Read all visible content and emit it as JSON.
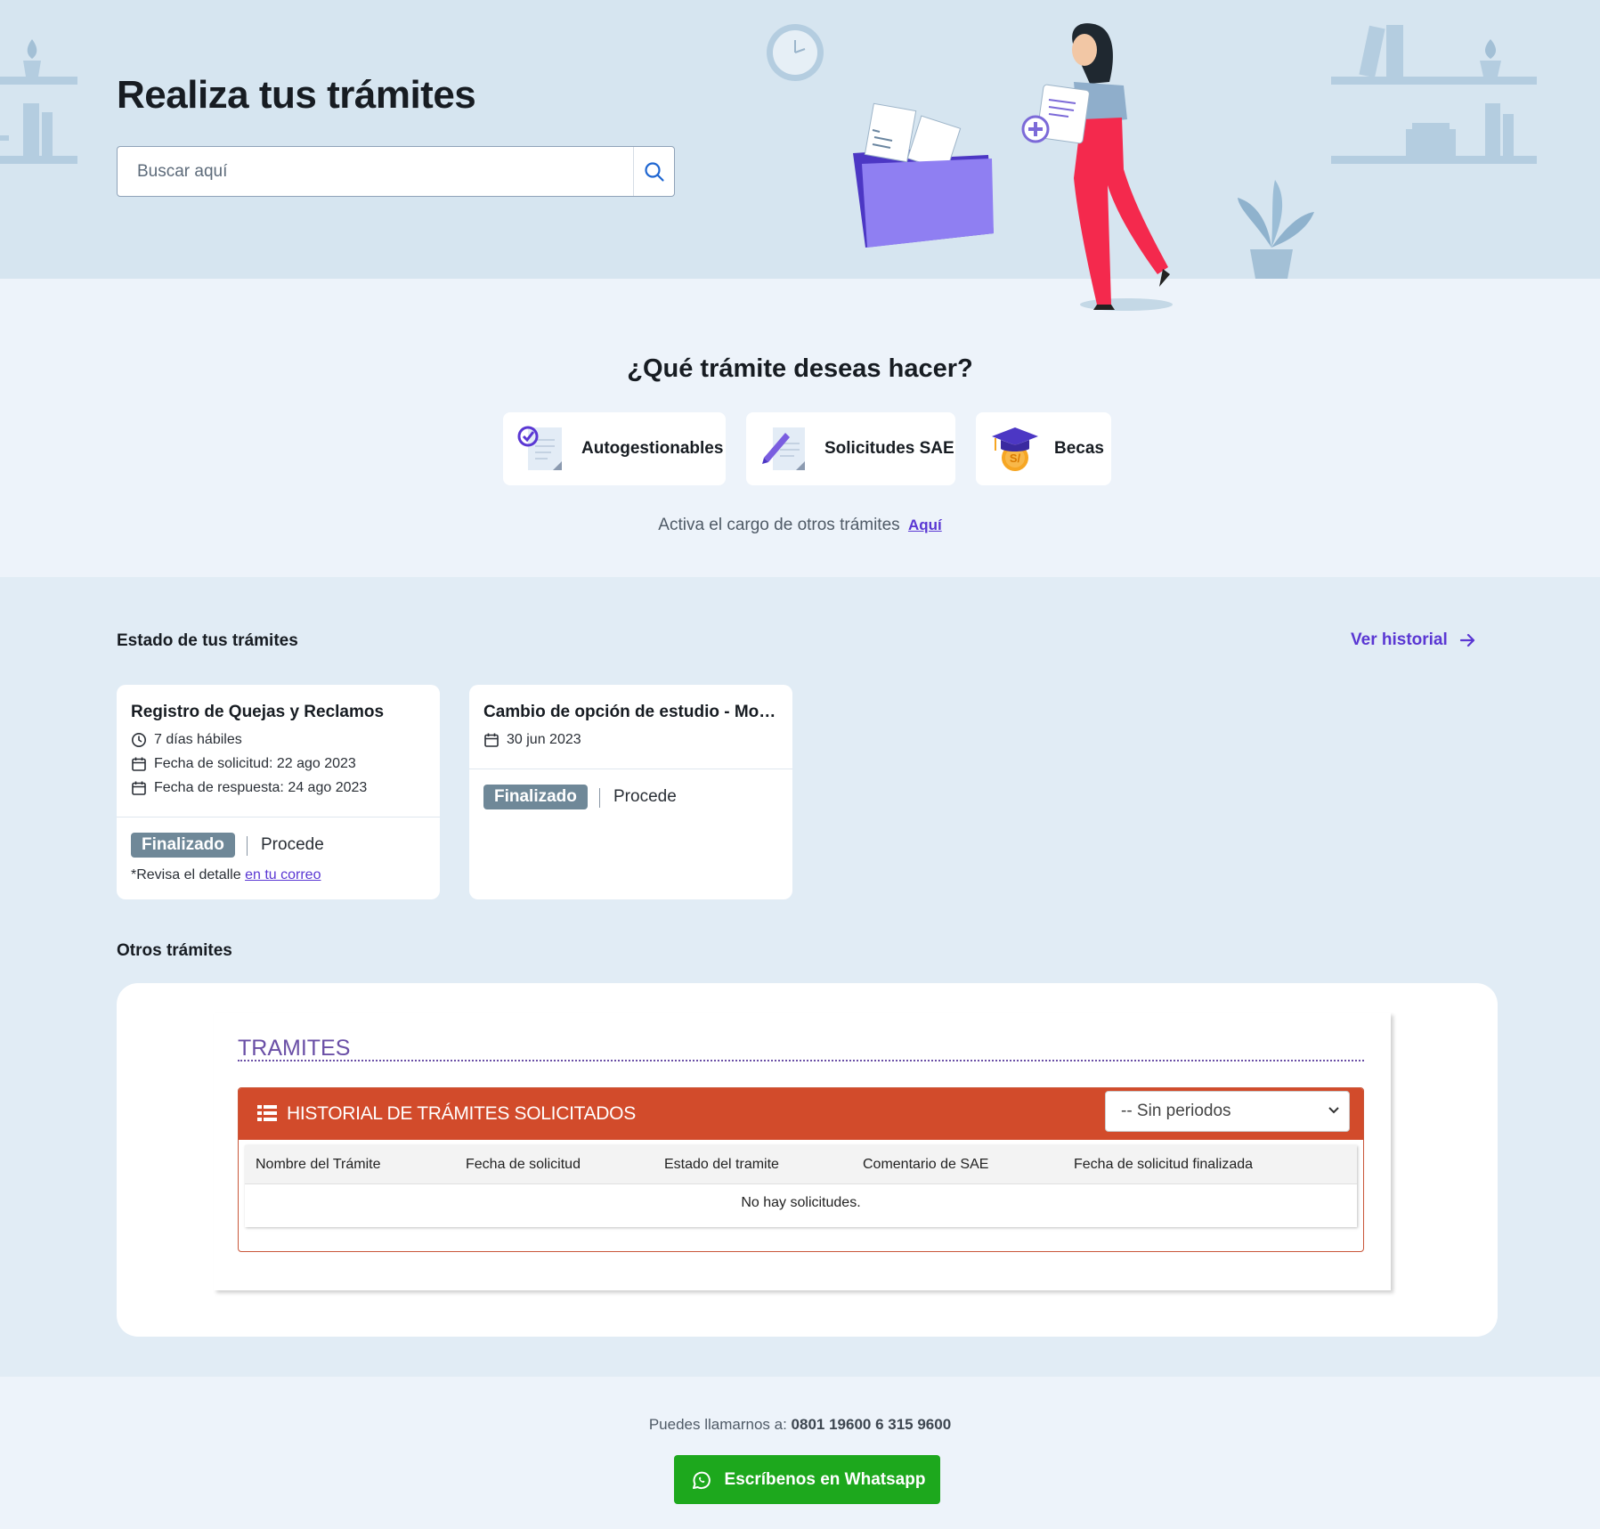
{
  "hero": {
    "title": "Realiza tus trámites",
    "search_placeholder": "Buscar aquí"
  },
  "types": {
    "title": "¿Qué trámite deseas hacer?",
    "items": [
      {
        "label": "Autogestionables",
        "icon": "self-service-document-icon"
      },
      {
        "label": "Solicitudes SAE",
        "icon": "pencil-document-icon"
      },
      {
        "label": "Becas",
        "icon": "graduation-cap-coin-icon"
      }
    ],
    "activa_text": "Activa el cargo de otros trámites",
    "activa_link": "Aquí"
  },
  "status": {
    "title": "Estado de tus trámites",
    "history_link": "Ver historial",
    "cards": [
      {
        "title": "Registro de Quejas y Reclamos",
        "lines": [
          "7 días hábiles",
          "Fecha de solicitud: 22 ago 2023",
          "Fecha de respuesta: 24 ago 2023"
        ],
        "badge": "Finalizado",
        "result": "Procede",
        "note": "*Revisa el detalle",
        "note_link": "en tu correo"
      },
      {
        "title": "Cambio de opción de estudio - Mod...",
        "lines": [
          "30 jun 2023"
        ],
        "badge": "Finalizado",
        "result": "Procede"
      }
    ]
  },
  "otros": {
    "title": "Otros trámites",
    "heading": "TRAMITES",
    "panel_title": "HISTORIAL DE TRÁMITES SOLICITADOS",
    "period_select": "-- Sin periodos",
    "columns": [
      "Nombre del Trámite",
      "Fecha de solicitud",
      "Estado del tramite",
      "Comentario de SAE",
      "Fecha de solicitud finalizada"
    ],
    "empty_message": "No hay solicitudes."
  },
  "footer": {
    "call_label": "Puedes llamarnos a:",
    "phone": "0801 19600 6 315 9600",
    "whatsapp_label": "Escríbenos en Whatsapp"
  },
  "colors": {
    "accent": "#5a37d3",
    "hero_bg": "#d6e5f0",
    "badge": "#6f8898",
    "panel_header": "#d24b2b",
    "whatsapp": "#1da81d"
  }
}
